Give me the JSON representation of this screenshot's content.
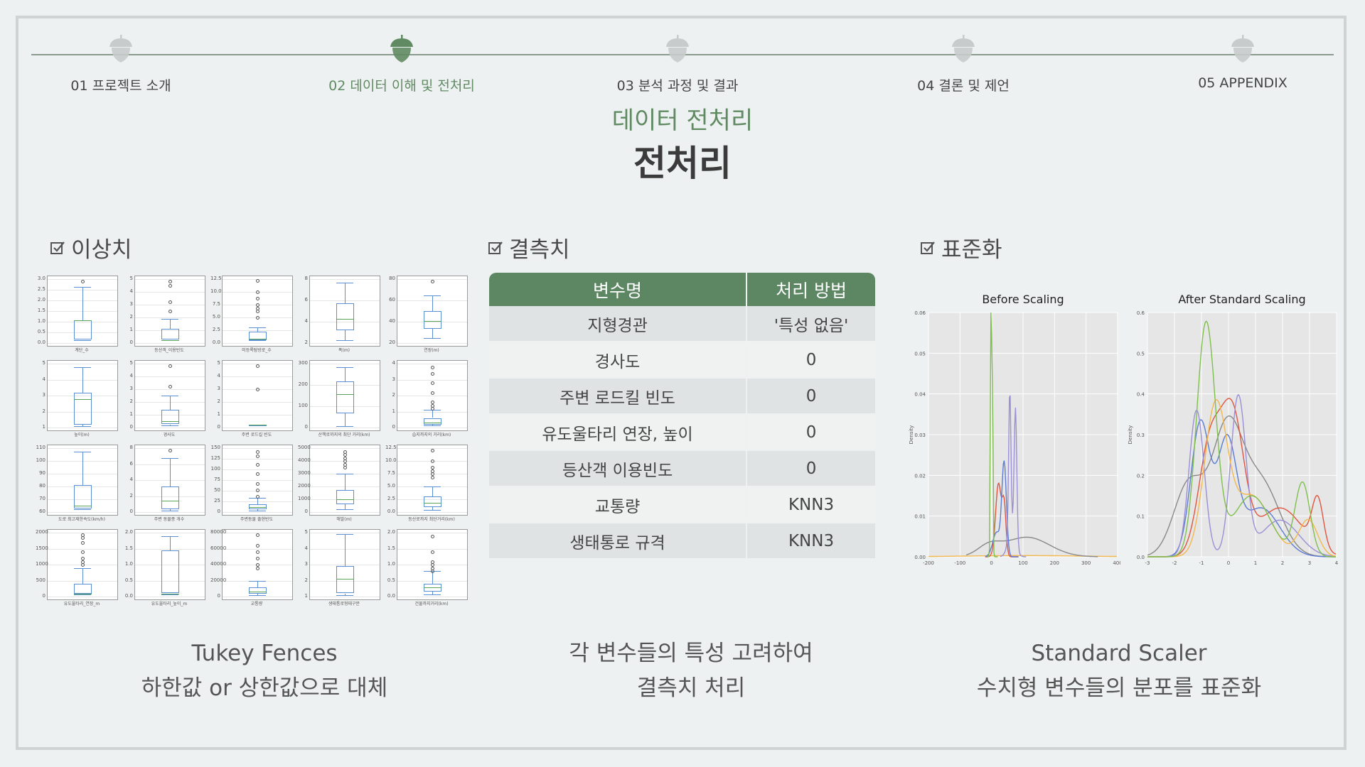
{
  "nav": {
    "items": [
      {
        "num": "01",
        "label": "프로젝트 소개"
      },
      {
        "num": "02",
        "label": "데이터 이해 및 전처리"
      },
      {
        "num": "03",
        "label": "분석 과정 및 결과"
      },
      {
        "num": "04",
        "label": "결론 및 제언"
      },
      {
        "num": "05",
        "label": "APPENDIX"
      }
    ],
    "active_index": 1
  },
  "header": {
    "subtitle": "데이터 전처리",
    "title": "전처리"
  },
  "outliers": {
    "heading": "이상치",
    "caption_line1": "Tukey Fences",
    "caption_line2": "하한값 or 상한값으로 대체",
    "boxplots": [
      {
        "ticks": [
          "3.0",
          "2.5",
          "2.0",
          "1.5",
          "1.0",
          "0.5",
          "0.0"
        ],
        "xlabel": "계단_수"
      },
      {
        "ticks": [
          "5",
          "4",
          "3",
          "2",
          "1",
          "0"
        ],
        "xlabel": "등산객_이용빈도"
      },
      {
        "ticks": [
          "12.5",
          "10.0",
          "7.5",
          "5.0",
          "2.5",
          "0.0"
        ],
        "xlabel": "미등록탐방로_수"
      },
      {
        "ticks": [
          "8",
          "6",
          "4",
          "2"
        ],
        "xlabel": "폭(m)"
      },
      {
        "ticks": [
          "80",
          "60",
          "40",
          "20"
        ],
        "xlabel": "연장(m)"
      },
      {
        "ticks": [
          "5",
          "4",
          "3",
          "2",
          "1"
        ],
        "xlabel": "높이(m)"
      },
      {
        "ticks": [
          "5",
          "4",
          "3",
          "2",
          "1",
          "0"
        ],
        "xlabel": "경사도"
      },
      {
        "ticks": [
          "5",
          "4",
          "3",
          "2",
          "1",
          "0"
        ],
        "xlabel": "주변 로드킬 빈도"
      },
      {
        "ticks": [
          "300",
          "200",
          "100",
          "0"
        ],
        "xlabel": "산책로까지의 최단 거리(km)"
      },
      {
        "ticks": [
          "4",
          "3",
          "2",
          "1",
          "0"
        ],
        "xlabel": "습지까지의 거리(km)"
      },
      {
        "ticks": [
          "110",
          "100",
          "90",
          "80",
          "70",
          "60"
        ],
        "xlabel": "도로 최고제한속도(km/h)"
      },
      {
        "ticks": [
          "8",
          "6",
          "4",
          "2",
          "0"
        ],
        "xlabel": "주변 동물종 개수"
      },
      {
        "ticks": [
          "150",
          "125",
          "100",
          "75",
          "50",
          "25",
          "0"
        ],
        "xlabel": "주변동물 출현빈도"
      },
      {
        "ticks": [
          "5000",
          "4000",
          "3000",
          "2000",
          "1000",
          "0"
        ],
        "xlabel": "해발(m)"
      },
      {
        "ticks": [
          "12.5",
          "10.0",
          "7.5",
          "5.0",
          "2.5",
          "0.0"
        ],
        "xlabel": "등산로까지 최단거리(km)"
      },
      {
        "ticks": [
          "2000",
          "1500",
          "1000",
          "500",
          "0"
        ],
        "xlabel": "유도울타리_연장_m"
      },
      {
        "ticks": [
          "2.0",
          "1.5",
          "1.0",
          "0.5",
          "0.0"
        ],
        "xlabel": "유도울타리_높이_m"
      },
      {
        "ticks": [
          "80000",
          "60000",
          "40000",
          "20000",
          "0"
        ],
        "xlabel": "교통량"
      },
      {
        "ticks": [
          "5",
          "4",
          "3",
          "2",
          "1"
        ],
        "xlabel": "생태통로형태구분"
      },
      {
        "ticks": [
          "2.0",
          "1.5",
          "1.0",
          "0.5",
          "0.0"
        ],
        "xlabel": "건물까지거리(km)"
      }
    ]
  },
  "missing": {
    "heading": "결측치",
    "columns": [
      "변수명",
      "처리 방법"
    ],
    "rows": [
      [
        "지형경관",
        "'특성 없음'"
      ],
      [
        "경사도",
        "0"
      ],
      [
        "주변 로드킬 빈도",
        "0"
      ],
      [
        "유도울타리 연장, 높이",
        "0"
      ],
      [
        "등산객 이용빈도",
        "0"
      ],
      [
        "교통량",
        "KNN3"
      ],
      [
        "생태통로 규격",
        "KNN3"
      ]
    ],
    "caption_line1": "각 변수들의 특성 고려하여",
    "caption_line2": "결측치 처리"
  },
  "scaling": {
    "heading": "표준화",
    "caption_line1": "Standard Scaler",
    "caption_line2": "수치형 변수들의 분포를 표준화",
    "before": {
      "title": "Before Scaling",
      "ylabel": "Density",
      "yticks": [
        "0.06",
        "0.05",
        "0.04",
        "0.03",
        "0.02",
        "0.01",
        "0.00"
      ],
      "xticks": [
        "-200",
        "-100",
        "0",
        "100",
        "200",
        "300",
        "400"
      ]
    },
    "after": {
      "title": "After Standard Scaling",
      "ylabel": "Density",
      "yticks": [
        "0.6",
        "0.5",
        "0.4",
        "0.3",
        "0.2",
        "0.1",
        "0.0"
      ],
      "xticks": [
        "-3",
        "-2",
        "-1",
        "0",
        "1",
        "2",
        "3",
        "4"
      ]
    }
  },
  "colors": {
    "accent": "#5f8a62",
    "inactive_acorn": "#c7cbcb",
    "box": "#5b8fd4",
    "median": "#5aa35a"
  }
}
